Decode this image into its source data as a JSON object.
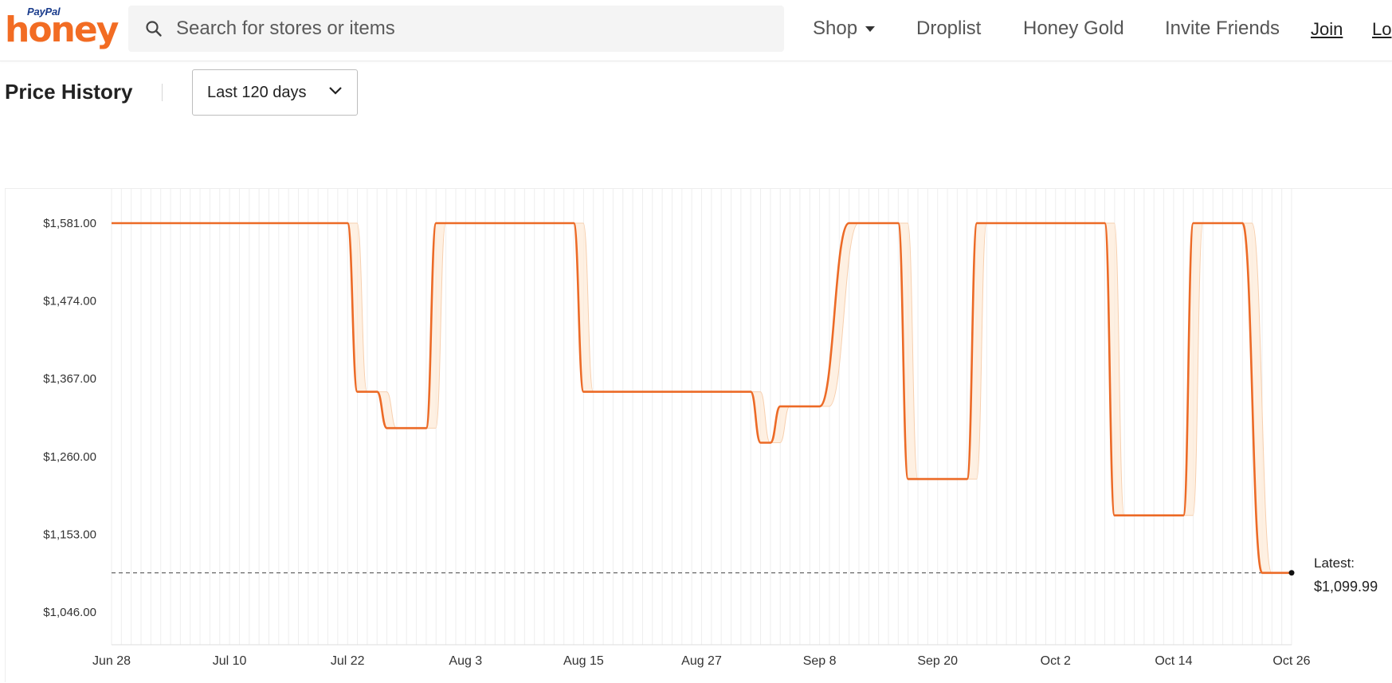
{
  "header": {
    "logo": {
      "small": "PayPal",
      "main": "honey"
    },
    "search": {
      "placeholder": "Search for stores or items",
      "icon": "search-icon"
    },
    "nav": {
      "shop": "Shop",
      "droplist": "Droplist",
      "honey_gold": "Honey Gold",
      "invite": "Invite Friends",
      "join": "Join",
      "login": "Lo"
    }
  },
  "price_history": {
    "title": "Price History",
    "range": "Last 120 days"
  },
  "colors": {
    "brand": "#f26c23",
    "line": "#ec6a26",
    "band": "#fde9d6",
    "grid": "#eeeeee",
    "text": "#1f1f1f"
  },
  "chart_data": {
    "type": "line",
    "title": "",
    "xlabel": "",
    "ylabel": "",
    "x_ticks": [
      "Jun 28",
      "Jul 10",
      "Jul 22",
      "Aug 3",
      "Aug 15",
      "Aug 27",
      "Sep 8",
      "Sep 20",
      "Oct 2",
      "Oct 14",
      "Oct 26"
    ],
    "y_ticks": [
      "$1,581.00",
      "$1,474.00",
      "$1,367.00",
      "$1,260.00",
      "$1,153.00",
      "$1,046.00"
    ],
    "ylim": [
      1046,
      1581
    ],
    "grid": true,
    "latest": {
      "label": "Latest:",
      "value": "$1,099.99",
      "price": 1099.99
    },
    "series": [
      {
        "points": [
          [
            "Jun 28",
            1581
          ],
          [
            "Jul 22",
            1581
          ],
          [
            "Jul 23",
            1349
          ],
          [
            "Jul 25",
            1349
          ],
          [
            "Jul 26",
            1299
          ],
          [
            "Jul 30",
            1299
          ],
          [
            "Jul 31",
            1581
          ],
          [
            "Aug 14",
            1581
          ],
          [
            "Aug 15",
            1349
          ],
          [
            "Sep 1",
            1349
          ],
          [
            "Sep 2",
            1279
          ],
          [
            "Sep 3",
            1279
          ],
          [
            "Sep 4",
            1329
          ],
          [
            "Sep 8",
            1329
          ],
          [
            "Sep 11",
            1581
          ],
          [
            "Sep 16",
            1581
          ],
          [
            "Sep 17",
            1229
          ],
          [
            "Sep 23",
            1229
          ],
          [
            "Sep 24",
            1581
          ],
          [
            "Oct 7",
            1581
          ],
          [
            "Oct 8",
            1179
          ],
          [
            "Oct 15",
            1179
          ],
          [
            "Oct 16",
            1581
          ],
          [
            "Oct 21",
            1581
          ],
          [
            "Oct 23",
            1099.99
          ],
          [
            "Oct 26",
            1099.99
          ]
        ]
      }
    ]
  }
}
